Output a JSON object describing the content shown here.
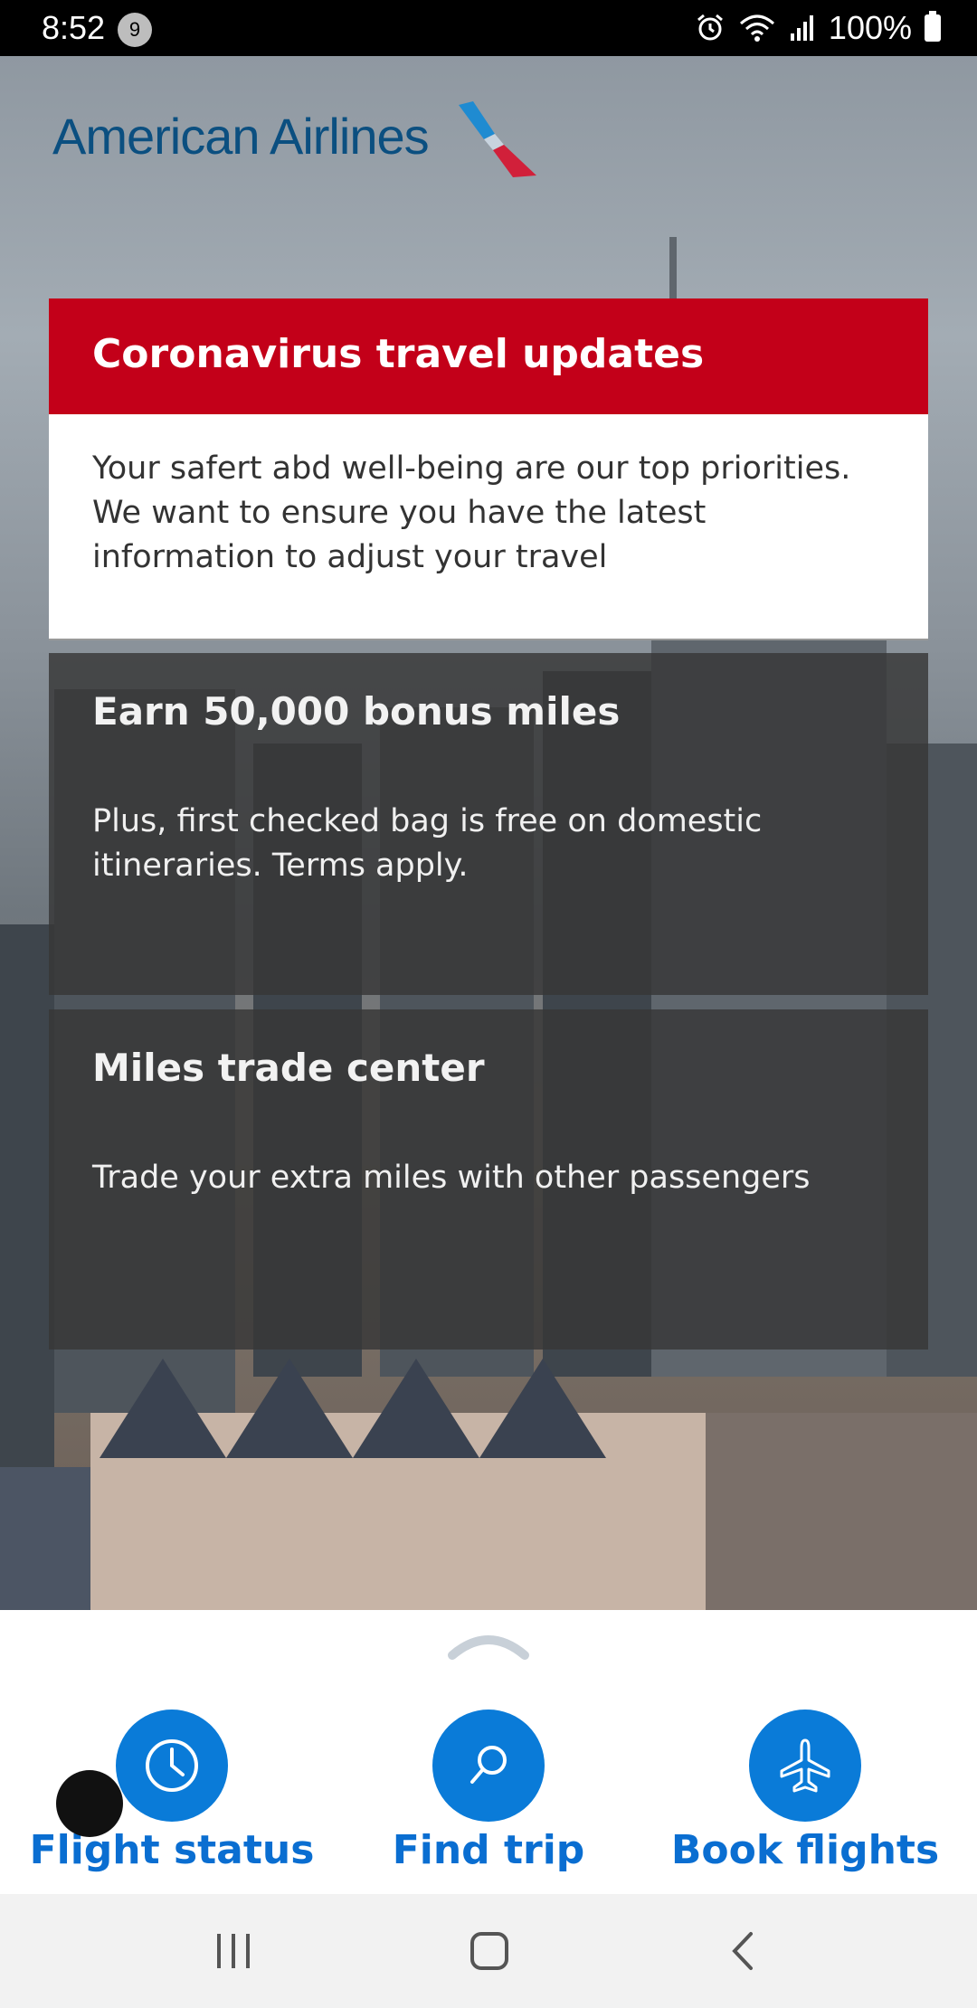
{
  "status_bar": {
    "time": "8:52",
    "notification_count": "9",
    "battery": "100%"
  },
  "logo": {
    "text": "American Airlines"
  },
  "cards": {
    "covid": {
      "title": "Coronavirus travel updates",
      "body": "Your safert abd well-being are our top priorities. We want to ensure you have the latest information to adjust your travel"
    },
    "bonus": {
      "title": "Earn 50,000 bonus miles",
      "body": "Plus, first checked bag is free on domestic itineraries. Terms apply."
    },
    "trade": {
      "title": "Miles trade center",
      "body": "Trade your extra miles with other passengers"
    }
  },
  "actions": [
    {
      "label": "Flight status",
      "icon": "clock-icon"
    },
    {
      "label": "Find trip",
      "icon": "search-icon"
    },
    {
      "label": "Book flights",
      "icon": "airplane-icon"
    }
  ],
  "colors": {
    "brand_red": "#c30019",
    "brand_blue": "#0a7bd8",
    "logo_blue": "#0b4f80"
  }
}
